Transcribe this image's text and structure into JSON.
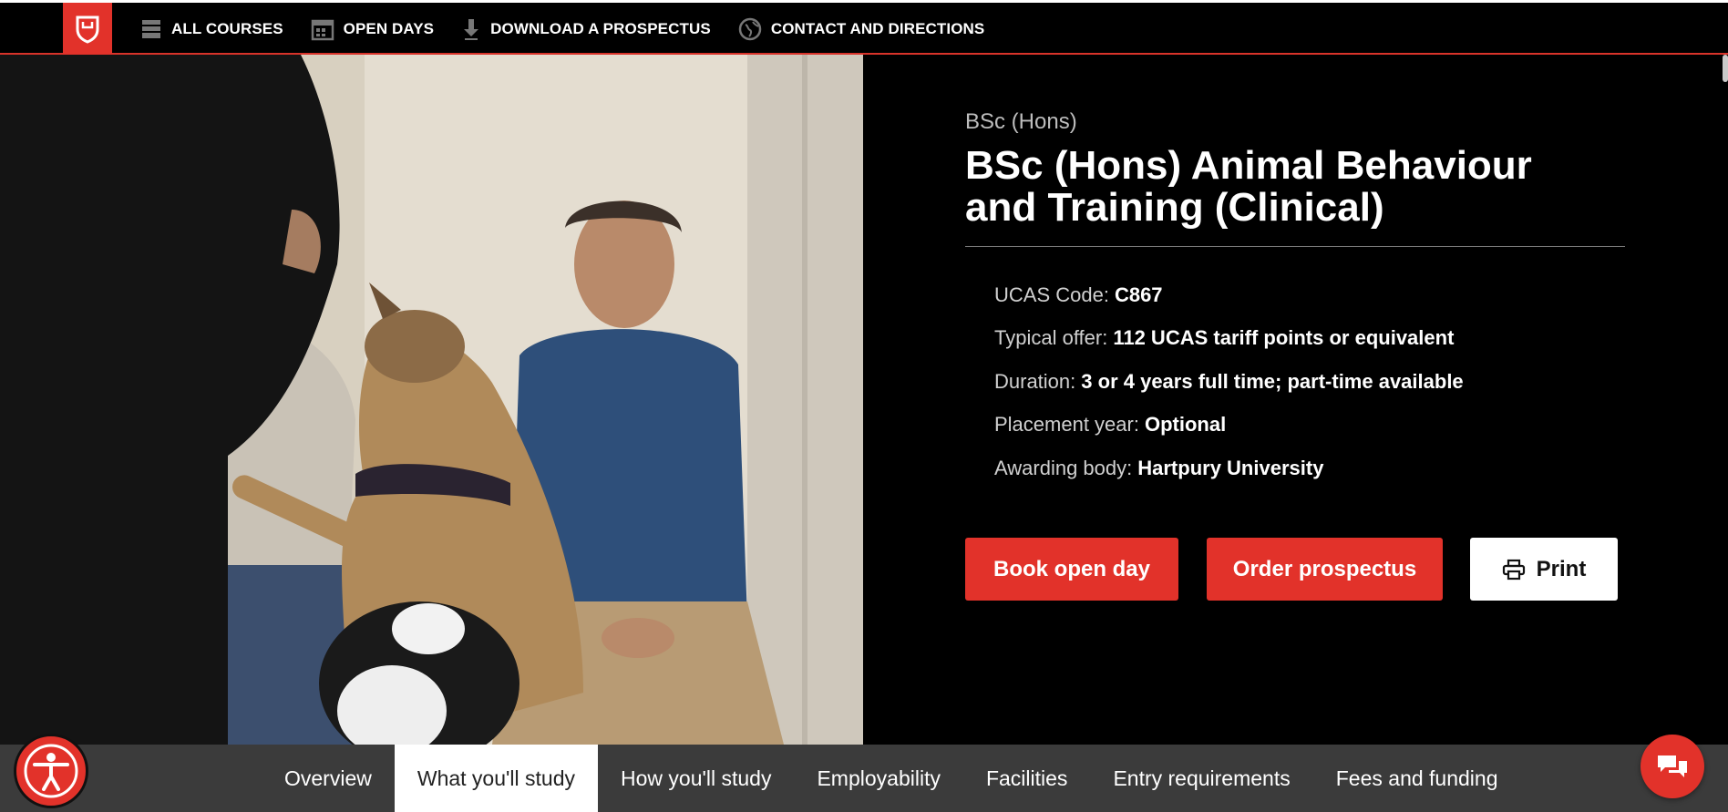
{
  "nav": {
    "items": [
      {
        "label": "ALL COURSES",
        "icon": "courses-icon"
      },
      {
        "label": "OPEN DAYS",
        "icon": "calendar-icon"
      },
      {
        "label": "DOWNLOAD A PROSPECTUS",
        "icon": "download-icon"
      },
      {
        "label": "CONTACT AND DIRECTIONS",
        "icon": "globe-icon"
      }
    ]
  },
  "course": {
    "subtitle": "BSc (Hons)",
    "title": "BSc (Hons) Animal Behaviour and Training (Clinical)",
    "facts": [
      {
        "label": "UCAS Code:",
        "value": "C867"
      },
      {
        "label": "Typical offer:",
        "value": "112 UCAS tariff points or equivalent"
      },
      {
        "label": "Duration:",
        "value": "3 or 4 years full time; part-time available"
      },
      {
        "label": "Placement year:",
        "value": "Optional"
      },
      {
        "label": "Awarding body:",
        "value": "Hartpury University"
      }
    ]
  },
  "buttons": {
    "open_day": "Book open day",
    "prospectus": "Order prospectus",
    "print": "Print"
  },
  "tabs": [
    {
      "label": "Overview"
    },
    {
      "label": "What you'll study"
    },
    {
      "label": "How you'll study"
    },
    {
      "label": "Employability"
    },
    {
      "label": "Facilities"
    },
    {
      "label": "Entry requirements"
    },
    {
      "label": "Fees and funding"
    }
  ],
  "active_tab": "What you'll study",
  "colors": {
    "brand_red": "#e2322a",
    "topbar": "#000000",
    "tabbar": "#3b3b3b"
  }
}
